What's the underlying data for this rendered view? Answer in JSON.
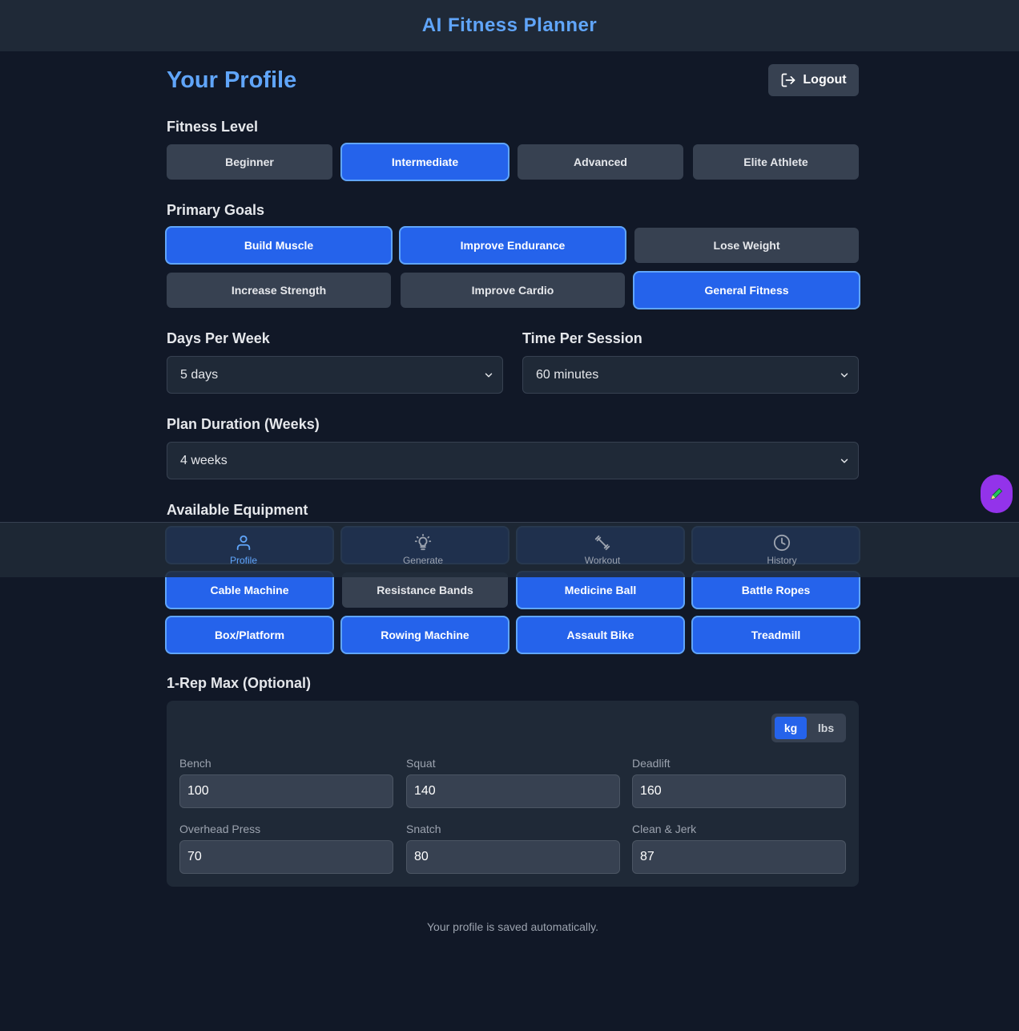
{
  "app": {
    "title": "AI Fitness Planner"
  },
  "header": {
    "title": "Your Profile",
    "logout_label": "Logout"
  },
  "fitness_level": {
    "label": "Fitness Level",
    "options": [
      {
        "label": "Beginner",
        "selected": false
      },
      {
        "label": "Intermediate",
        "selected": true
      },
      {
        "label": "Advanced",
        "selected": false
      },
      {
        "label": "Elite Athlete",
        "selected": false
      }
    ]
  },
  "goals": {
    "label": "Primary Goals",
    "options": [
      {
        "label": "Build Muscle",
        "selected": true
      },
      {
        "label": "Improve Endurance",
        "selected": true
      },
      {
        "label": "Lose Weight",
        "selected": false
      },
      {
        "label": "Increase Strength",
        "selected": false
      },
      {
        "label": "Improve Cardio",
        "selected": false
      },
      {
        "label": "General Fitness",
        "selected": true
      }
    ]
  },
  "days_per_week": {
    "label": "Days Per Week",
    "value": "5 days"
  },
  "time_per_session": {
    "label": "Time Per Session",
    "value": "60 minutes"
  },
  "plan_duration": {
    "label": "Plan Duration (Weeks)",
    "value": "4 weeks"
  },
  "equipment": {
    "label": "Available Equipment",
    "options": [
      {
        "label": "Cable Machine",
        "selected": true
      },
      {
        "label": "Resistance Bands",
        "selected": false
      },
      {
        "label": "Medicine Ball",
        "selected": true
      },
      {
        "label": "Battle Ropes",
        "selected": true
      },
      {
        "label": "Box/Platform",
        "selected": true
      },
      {
        "label": "Rowing Machine",
        "selected": true
      },
      {
        "label": "Assault Bike",
        "selected": true
      },
      {
        "label": "Treadmill",
        "selected": true
      }
    ]
  },
  "one_rep_max": {
    "label": "1-Rep Max (Optional)",
    "units": {
      "kg": "kg",
      "lbs": "lbs",
      "active": "kg"
    },
    "lifts": [
      {
        "label": "Bench",
        "value": "100"
      },
      {
        "label": "Squat",
        "value": "140"
      },
      {
        "label": "Deadlift",
        "value": "160"
      },
      {
        "label": "Overhead Press",
        "value": "70"
      },
      {
        "label": "Snatch",
        "value": "80"
      },
      {
        "label": "Clean & Jerk",
        "value": "87"
      }
    ]
  },
  "footer": {
    "note": "Your profile is saved automatically."
  },
  "nav": {
    "items": [
      {
        "label": "Profile",
        "icon": "user-icon",
        "active": true
      },
      {
        "label": "Generate",
        "icon": "lightbulb-icon",
        "active": false
      },
      {
        "label": "Workout",
        "icon": "dumbbell-icon",
        "active": false
      },
      {
        "label": "History",
        "icon": "clock-icon",
        "active": false
      }
    ]
  },
  "colors": {
    "background": "#111827",
    "surface": "#1f2937",
    "accent": "#60a5fa",
    "selected": "#2563eb",
    "fab": "#9333ea"
  }
}
